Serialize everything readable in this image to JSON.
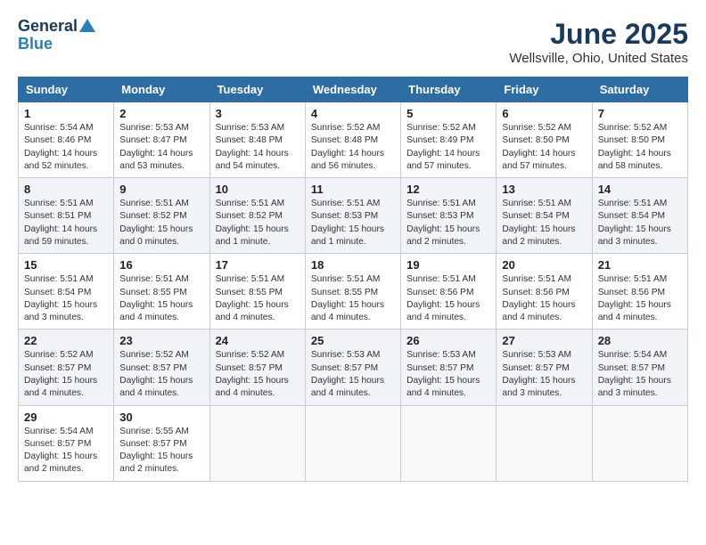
{
  "header": {
    "logo_line1": "General",
    "logo_line2": "Blue",
    "month": "June 2025",
    "location": "Wellsville, Ohio, United States"
  },
  "weekdays": [
    "Sunday",
    "Monday",
    "Tuesday",
    "Wednesday",
    "Thursday",
    "Friday",
    "Saturday"
  ],
  "weeks": [
    [
      {
        "day": "1",
        "info": "Sunrise: 5:54 AM\nSunset: 8:46 PM\nDaylight: 14 hours\nand 52 minutes."
      },
      {
        "day": "2",
        "info": "Sunrise: 5:53 AM\nSunset: 8:47 PM\nDaylight: 14 hours\nand 53 minutes."
      },
      {
        "day": "3",
        "info": "Sunrise: 5:53 AM\nSunset: 8:48 PM\nDaylight: 14 hours\nand 54 minutes."
      },
      {
        "day": "4",
        "info": "Sunrise: 5:52 AM\nSunset: 8:48 PM\nDaylight: 14 hours\nand 56 minutes."
      },
      {
        "day": "5",
        "info": "Sunrise: 5:52 AM\nSunset: 8:49 PM\nDaylight: 14 hours\nand 57 minutes."
      },
      {
        "day": "6",
        "info": "Sunrise: 5:52 AM\nSunset: 8:50 PM\nDaylight: 14 hours\nand 57 minutes."
      },
      {
        "day": "7",
        "info": "Sunrise: 5:52 AM\nSunset: 8:50 PM\nDaylight: 14 hours\nand 58 minutes."
      }
    ],
    [
      {
        "day": "8",
        "info": "Sunrise: 5:51 AM\nSunset: 8:51 PM\nDaylight: 14 hours\nand 59 minutes."
      },
      {
        "day": "9",
        "info": "Sunrise: 5:51 AM\nSunset: 8:52 PM\nDaylight: 15 hours\nand 0 minutes."
      },
      {
        "day": "10",
        "info": "Sunrise: 5:51 AM\nSunset: 8:52 PM\nDaylight: 15 hours\nand 1 minute."
      },
      {
        "day": "11",
        "info": "Sunrise: 5:51 AM\nSunset: 8:53 PM\nDaylight: 15 hours\nand 1 minute."
      },
      {
        "day": "12",
        "info": "Sunrise: 5:51 AM\nSunset: 8:53 PM\nDaylight: 15 hours\nand 2 minutes."
      },
      {
        "day": "13",
        "info": "Sunrise: 5:51 AM\nSunset: 8:54 PM\nDaylight: 15 hours\nand 2 minutes."
      },
      {
        "day": "14",
        "info": "Sunrise: 5:51 AM\nSunset: 8:54 PM\nDaylight: 15 hours\nand 3 minutes."
      }
    ],
    [
      {
        "day": "15",
        "info": "Sunrise: 5:51 AM\nSunset: 8:54 PM\nDaylight: 15 hours\nand 3 minutes."
      },
      {
        "day": "16",
        "info": "Sunrise: 5:51 AM\nSunset: 8:55 PM\nDaylight: 15 hours\nand 4 minutes."
      },
      {
        "day": "17",
        "info": "Sunrise: 5:51 AM\nSunset: 8:55 PM\nDaylight: 15 hours\nand 4 minutes."
      },
      {
        "day": "18",
        "info": "Sunrise: 5:51 AM\nSunset: 8:55 PM\nDaylight: 15 hours\nand 4 minutes."
      },
      {
        "day": "19",
        "info": "Sunrise: 5:51 AM\nSunset: 8:56 PM\nDaylight: 15 hours\nand 4 minutes."
      },
      {
        "day": "20",
        "info": "Sunrise: 5:51 AM\nSunset: 8:56 PM\nDaylight: 15 hours\nand 4 minutes."
      },
      {
        "day": "21",
        "info": "Sunrise: 5:51 AM\nSunset: 8:56 PM\nDaylight: 15 hours\nand 4 minutes."
      }
    ],
    [
      {
        "day": "22",
        "info": "Sunrise: 5:52 AM\nSunset: 8:57 PM\nDaylight: 15 hours\nand 4 minutes."
      },
      {
        "day": "23",
        "info": "Sunrise: 5:52 AM\nSunset: 8:57 PM\nDaylight: 15 hours\nand 4 minutes."
      },
      {
        "day": "24",
        "info": "Sunrise: 5:52 AM\nSunset: 8:57 PM\nDaylight: 15 hours\nand 4 minutes."
      },
      {
        "day": "25",
        "info": "Sunrise: 5:53 AM\nSunset: 8:57 PM\nDaylight: 15 hours\nand 4 minutes."
      },
      {
        "day": "26",
        "info": "Sunrise: 5:53 AM\nSunset: 8:57 PM\nDaylight: 15 hours\nand 4 minutes."
      },
      {
        "day": "27",
        "info": "Sunrise: 5:53 AM\nSunset: 8:57 PM\nDaylight: 15 hours\nand 3 minutes."
      },
      {
        "day": "28",
        "info": "Sunrise: 5:54 AM\nSunset: 8:57 PM\nDaylight: 15 hours\nand 3 minutes."
      }
    ],
    [
      {
        "day": "29",
        "info": "Sunrise: 5:54 AM\nSunset: 8:57 PM\nDaylight: 15 hours\nand 2 minutes."
      },
      {
        "day": "30",
        "info": "Sunrise: 5:55 AM\nSunset: 8:57 PM\nDaylight: 15 hours\nand 2 minutes."
      },
      {
        "day": "",
        "info": ""
      },
      {
        "day": "",
        "info": ""
      },
      {
        "day": "",
        "info": ""
      },
      {
        "day": "",
        "info": ""
      },
      {
        "day": "",
        "info": ""
      }
    ]
  ]
}
